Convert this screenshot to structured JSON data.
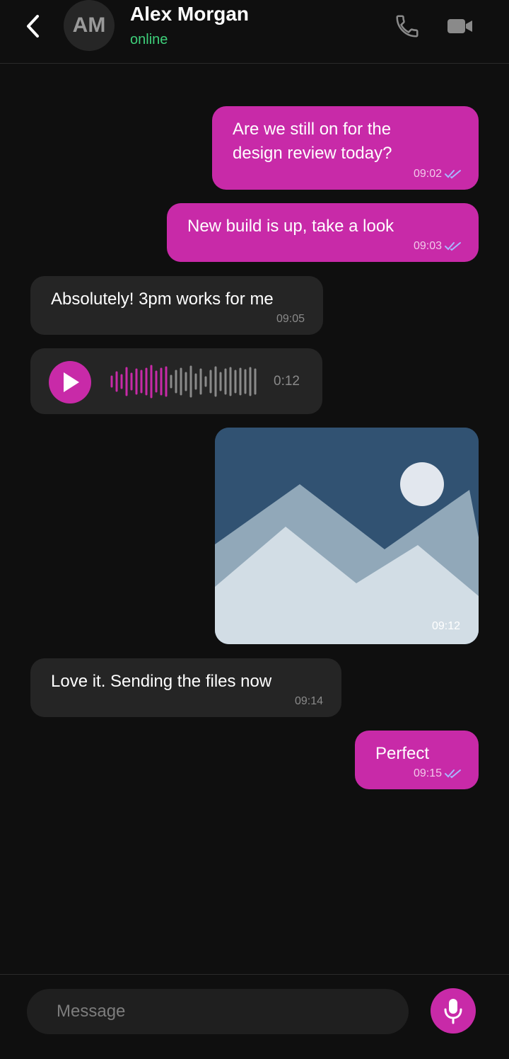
{
  "header": {
    "back_icon": "chevron-left-icon",
    "avatar_initials": "AM",
    "contact_name": "Alex Morgan",
    "status": "online",
    "call_icon": "phone-icon",
    "video_icon": "video-camera-icon"
  },
  "colors": {
    "background": "#0f0f0f",
    "accent": "#c82aa8",
    "incoming_bubble": "#252525",
    "online": "#3ecf7a",
    "read_ticks": "#a9b6ff"
  },
  "messages": [
    {
      "direction": "outgoing",
      "type": "text",
      "text_lines": [
        "Are we still on for the",
        "design review today?"
      ],
      "time": "09:02",
      "status_icon": "double-check-icon"
    },
    {
      "direction": "outgoing",
      "type": "text",
      "text": "New build is up, take a look",
      "time": "09:03",
      "status_icon": "double-check-icon"
    },
    {
      "direction": "incoming",
      "type": "text",
      "text": "Absolutely! 3pm works for me",
      "time": "09:05"
    },
    {
      "direction": "incoming",
      "type": "voice",
      "duration": "0:12",
      "played_fraction": 0.4,
      "play_icon": "play-icon"
    },
    {
      "direction": "outgoing",
      "type": "image",
      "image_icon": "landscape-image-icon",
      "time": "09:12"
    },
    {
      "direction": "incoming",
      "type": "text",
      "text": "Love it. Sending the files now",
      "time": "09:14"
    },
    {
      "direction": "outgoing",
      "type": "text",
      "text": "Perfect",
      "time": "09:15",
      "status_icon": "double-check-icon"
    }
  ],
  "composer": {
    "placeholder": "Message",
    "mic_icon": "microphone-icon"
  }
}
